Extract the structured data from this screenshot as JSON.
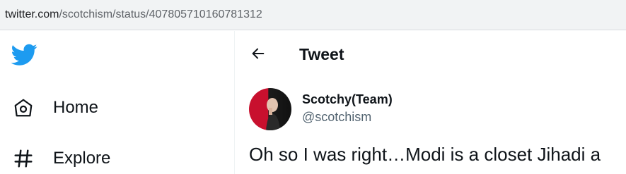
{
  "browser": {
    "url_domain": "twitter.com",
    "url_path": "/scotchism/status/407805710160781312"
  },
  "sidebar": {
    "logo_icon": "twitter-bird-icon",
    "brand_color": "#1d9bf0",
    "items": [
      {
        "label": "Home",
        "icon": "home-icon"
      },
      {
        "label": "Explore",
        "icon": "hashtag-icon"
      }
    ]
  },
  "header": {
    "title": "Tweet",
    "back_icon": "arrow-left-icon"
  },
  "tweet": {
    "display_name": "Scotchy(Team)",
    "handle": "@scotchism",
    "text": "Oh so I was right…Modi is a closet Jihadi a",
    "text_line_2": ""
  }
}
